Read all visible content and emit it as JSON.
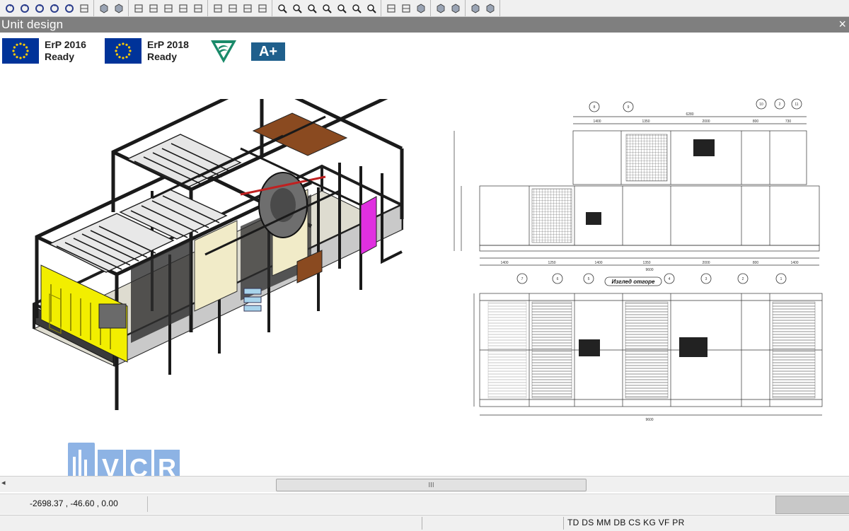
{
  "window": {
    "title": "Unit design"
  },
  "toolbar": {
    "groups": [
      [
        "refresh-icon",
        "rotate-left-icon",
        "rotate-right-icon",
        "rotate-x-icon",
        "rotate-y-icon",
        "check-icon"
      ],
      [
        "solid-cube-icon",
        "solid-cube-2-icon"
      ],
      [
        "move-icon",
        "pan-icon",
        "link-icon",
        "align-icon",
        "measure-icon"
      ],
      [
        "grid-icon",
        "table-icon",
        "table-2-icon",
        "frame-icon"
      ],
      [
        "zoom-window-icon",
        "zoom-out-icon",
        "zoom-extents-icon",
        "zoom-in-icon",
        "zoom-minus-icon",
        "zoom-all-icon",
        "zoom-dynamic-icon"
      ],
      [
        "properties-icon",
        "select-icon",
        "cube-icon"
      ],
      [
        "layers-icon",
        "box-icon"
      ],
      [
        "layers-2-icon",
        "box-2-icon"
      ]
    ]
  },
  "badges": {
    "erp2016": {
      "line1": "ErP 2016",
      "line2": "Ready"
    },
    "erp2018": {
      "line1": "ErP 2018",
      "line2": "Ready"
    },
    "energy_class": "A+"
  },
  "drawing": {
    "caption": "Изглед отгоре",
    "top_dims": [
      "1400",
      "1350",
      "2000",
      "800",
      "730"
    ],
    "overall_dim": "6280",
    "callouts_top": [
      "8",
      "9",
      "10",
      "2",
      "11"
    ],
    "callouts_bottom": [
      "7",
      "6",
      "5",
      "4",
      "3",
      "2",
      "1"
    ],
    "bottom_dims": [
      "1400",
      "1250",
      "1400",
      "1350",
      "2000",
      "800",
      "1400"
    ],
    "overall_bottom": "9600",
    "plan_dims": [
      "9600"
    ]
  },
  "logo": {
    "text": "VCR"
  },
  "scrollbar": {
    "thumb_grip": "III"
  },
  "coords": {
    "value": "-2698.37 , -46.60 , 0.00"
  },
  "status": {
    "flags": "TD DS MM DB CS KG VF PR"
  },
  "colors": {
    "eu_blue": "#003399",
    "title_gray": "#7f7f7f",
    "filter_yellow": "#f2ee00",
    "magenta": "#e030e0"
  }
}
